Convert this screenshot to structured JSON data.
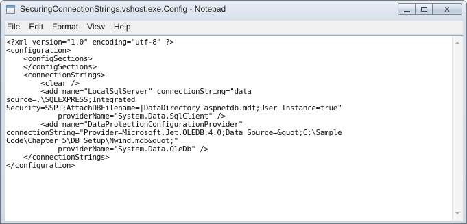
{
  "window": {
    "title": "SecuringConnectionStrings.vshost.exe.Config - Notepad",
    "icon": "notepad-icon"
  },
  "caption_buttons": {
    "minimize_icon": "minimize-icon",
    "maximize_icon": "maximize-icon",
    "close_icon": "close-icon"
  },
  "menu": {
    "items": [
      {
        "label": "File"
      },
      {
        "label": "Edit"
      },
      {
        "label": "Format"
      },
      {
        "label": "View"
      },
      {
        "label": "Help"
      }
    ]
  },
  "editor": {
    "content": "<?xml version=\"1.0\" encoding=\"utf-8\" ?>\n<configuration>\n    <configSections>\n    </configSections>\n    <connectionStrings>\n        <clear />\n        <add name=\"LocalSqlServer\" connectionString=\"data\nsource=.\\SQLEXPRESS;Integrated\nSecurity=SSPI;AttachDBFilename=|DataDirectory|aspnetdb.mdf;User Instance=true\"\n            providerName=\"System.Data.SqlClient\" />\n        <add name=\"DataProtectionConfigurationProvider\"\nconnectionString=\"Provider=Microsoft.Jet.OLEDB.4.0;Data Source=&quot;C:\\Sample\nCode\\Chapter 5\\DB Setup\\Nwind.mdb&quot;\"\n            providerName=\"System.Data.OleDb\" />\n    </connectionStrings>\n</configuration>"
  },
  "colors": {
    "titlebar": "#d7e0eb",
    "menubar": "#f0f0f0",
    "editor_bg": "#ffffff",
    "text": "#101010"
  }
}
